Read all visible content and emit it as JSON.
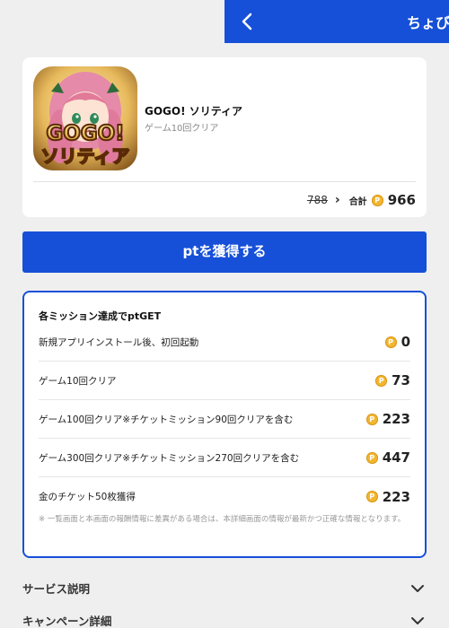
{
  "header": {
    "title": "ちょびリッチ",
    "back_icon": "chevron-left-icon",
    "color": "#1650d8"
  },
  "app": {
    "name": "GOGO! ソリティア",
    "subtitle": "ゲーム10回クリア",
    "icon_text_line1": "GOGO!",
    "icon_text_line2": "ソリティア",
    "old_points": "788",
    "total_label": "合計",
    "total_points": "966",
    "coin_symbol": "P"
  },
  "cta": {
    "label": "ptを獲得する"
  },
  "missions": {
    "heading": "各ミッション達成でptGET",
    "items": [
      {
        "label": "新規アプリインストール後、初回起動",
        "points": "0"
      },
      {
        "label": "ゲーム10回クリア",
        "points": "73"
      },
      {
        "label": "ゲーム100回クリア※チケットミッション90回クリアを含む",
        "points": "223"
      },
      {
        "label": "ゲーム300回クリア※チケットミッション270回クリアを含む",
        "points": "447"
      },
      {
        "label": "金のチケット50枚獲得",
        "points": "223"
      }
    ],
    "note": "※ 一覧画面と本画面の報酬情報に差異がある場合は、本詳細画面の情報が最新かつ正確な情報となります。"
  },
  "sections": [
    {
      "label": "サービス説明"
    },
    {
      "label": "キャンペーン詳細"
    }
  ],
  "colors": {
    "accent": "#1650d8",
    "coin": "#f2b630",
    "background": "#efefef"
  }
}
